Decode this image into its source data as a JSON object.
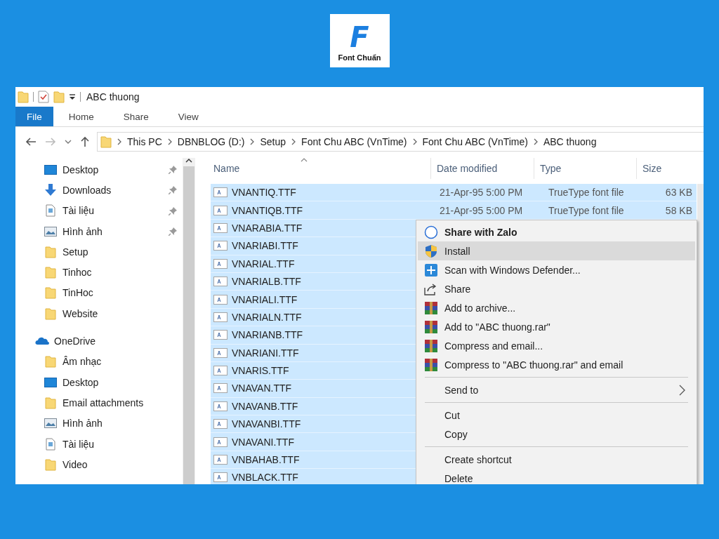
{
  "logo": {
    "mark": "F",
    "text": "Font Chuẩn"
  },
  "window": {
    "title": "ABC thuong"
  },
  "ribbon_tabs": [
    {
      "label": "File",
      "selected": true
    },
    {
      "label": "Home",
      "selected": false
    },
    {
      "label": "Share",
      "selected": false
    },
    {
      "label": "View",
      "selected": false
    }
  ],
  "address": {
    "breadcrumbs": [
      "This PC",
      "DBNBLOG (D:)",
      "Setup",
      "Font Chu ABC (VnTime)",
      "Font Chu ABC (VnTime)",
      "ABC thuong"
    ]
  },
  "nav": {
    "quick_access": [
      {
        "label": "Desktop",
        "kind": "desktop",
        "pinned": true
      },
      {
        "label": "Downloads",
        "kind": "download",
        "pinned": true
      },
      {
        "label": "Tài liệu",
        "kind": "document",
        "pinned": true
      },
      {
        "label": "Hình ảnh",
        "kind": "pictures",
        "pinned": true
      },
      {
        "label": "Setup",
        "kind": "folder",
        "pinned": false
      },
      {
        "label": "Tinhoc",
        "kind": "folder",
        "pinned": false
      },
      {
        "label": "TinHoc",
        "kind": "folder",
        "pinned": false
      },
      {
        "label": "Website",
        "kind": "folder",
        "pinned": false
      }
    ],
    "onedrive": {
      "label": "OneDrive",
      "children": [
        {
          "label": "Âm nhạc",
          "kind": "folder",
          "pinned": false
        },
        {
          "label": "Desktop",
          "kind": "desktop",
          "pinned": false
        },
        {
          "label": "Email attachments",
          "kind": "folder",
          "pinned": false
        },
        {
          "label": "Hình ảnh",
          "kind": "pictures",
          "pinned": false
        },
        {
          "label": "Tài liệu",
          "kind": "document",
          "pinned": false
        },
        {
          "label": "Video",
          "kind": "folder",
          "pinned": false
        }
      ]
    }
  },
  "files": {
    "columns": [
      {
        "label": "Name",
        "sorted": true
      },
      {
        "label": "Date modified",
        "sorted": false
      },
      {
        "label": "Type",
        "sorted": false
      },
      {
        "label": "Size",
        "sorted": false
      }
    ],
    "rows": [
      {
        "name": "VNANTIQ.TTF",
        "date": "21-Apr-95 5:00 PM",
        "type": "TrueType font file",
        "size": "63 KB",
        "selected": true
      },
      {
        "name": "VNANTIQB.TTF",
        "date": "21-Apr-95 5:00 PM",
        "type": "TrueType font file",
        "size": "58 KB",
        "selected": true
      },
      {
        "name": "VNARABIA.TTF",
        "selected": true
      },
      {
        "name": "VNARIABI.TTF",
        "selected": true
      },
      {
        "name": "VNARIAL.TTF",
        "selected": true
      },
      {
        "name": "VNARIALB.TTF",
        "selected": true
      },
      {
        "name": "VNARIALI.TTF",
        "selected": true
      },
      {
        "name": "VNARIALN.TTF",
        "selected": true
      },
      {
        "name": "VNARIANB.TTF",
        "selected": true
      },
      {
        "name": "VNARIANI.TTF",
        "selected": true
      },
      {
        "name": "VNARIS.TTF",
        "selected": true
      },
      {
        "name": "VNAVAN.TTF",
        "selected": true
      },
      {
        "name": "VNAVANB.TTF",
        "selected": true
      },
      {
        "name": "VNAVANBI.TTF",
        "selected": true
      },
      {
        "name": "VNAVANI.TTF",
        "selected": true
      },
      {
        "name": "VNBAHAB.TTF",
        "selected": true
      },
      {
        "name": "VNBLACK.TTF",
        "selected": true
      }
    ]
  },
  "context_menu": {
    "items": [
      {
        "kind": "item",
        "label": "Share with Zalo",
        "default": true,
        "selected": false
      },
      {
        "kind": "item",
        "label": "Install",
        "default": false,
        "selected": true
      },
      {
        "kind": "item",
        "label": "Scan with Windows Defender...",
        "default": false,
        "selected": false
      },
      {
        "kind": "item",
        "label": "Share",
        "default": false,
        "selected": false
      },
      {
        "kind": "item",
        "label": "Add to archive...",
        "default": false,
        "selected": false
      },
      {
        "kind": "item",
        "label": "Add to \"ABC thuong.rar\"",
        "default": false,
        "selected": false
      },
      {
        "kind": "item",
        "label": "Compress and email...",
        "default": false,
        "selected": false
      },
      {
        "kind": "item",
        "label": "Compress to \"ABC thuong.rar\" and email",
        "default": false,
        "selected": false
      },
      {
        "kind": "separator"
      },
      {
        "kind": "submenu",
        "label": "Send to",
        "default": false,
        "selected": false
      },
      {
        "kind": "separator"
      },
      {
        "kind": "item",
        "label": "Cut",
        "default": false,
        "selected": false
      },
      {
        "kind": "item",
        "label": "Copy",
        "default": false,
        "selected": false
      },
      {
        "kind": "separator"
      },
      {
        "kind": "item",
        "label": "Create shortcut",
        "default": false,
        "selected": false
      },
      {
        "kind": "item",
        "label": "Delete",
        "default": false,
        "selected": false
      }
    ]
  }
}
